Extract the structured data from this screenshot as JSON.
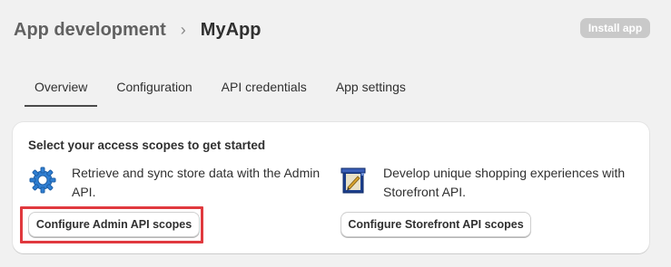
{
  "breadcrumb": {
    "parent": "App development",
    "separator": "›",
    "current": "MyApp"
  },
  "header": {
    "install_label": "Install app"
  },
  "tabs": [
    {
      "label": "Overview",
      "active": true
    },
    {
      "label": "Configuration",
      "active": false
    },
    {
      "label": "API credentials",
      "active": false
    },
    {
      "label": "App settings",
      "active": false
    }
  ],
  "card": {
    "title": "Select your access scopes to get started",
    "admin": {
      "icon": "gear-icon",
      "description": "Retrieve and sync store data with the Admin API.",
      "button_label": "Configure Admin API scopes"
    },
    "storefront": {
      "icon": "storefront-icon",
      "description": "Develop unique shopping experiences with Storefront API.",
      "button_label": "Configure Storefront API scopes"
    }
  },
  "colors": {
    "highlight": "#e0393e",
    "install_disabled": "#c9c9c9",
    "background": "#f1f1f1"
  }
}
